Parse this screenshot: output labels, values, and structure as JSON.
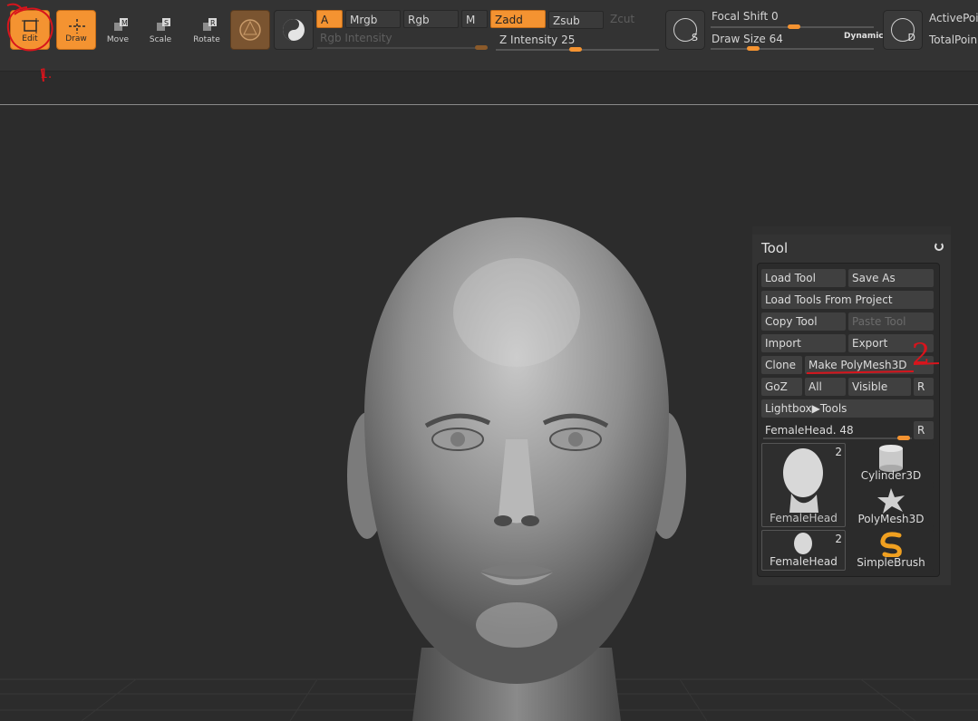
{
  "shelf": {
    "edit_label": "Edit",
    "draw_label": "Draw",
    "move_label": "Move",
    "scale_label": "Scale",
    "rotate_label": "Rotate",
    "modes": {
      "a": "A",
      "mrgb": "Mrgb",
      "rgb": "Rgb",
      "m": "M",
      "zadd": "Zadd",
      "zsub": "Zsub",
      "zcut": "Zcut"
    },
    "rgb_intensity_label": "Rgb Intensity",
    "z_intensity_label": "Z Intensity",
    "z_intensity_value": "25",
    "stroke_letter": "S",
    "focal_shift_label": "Focal Shift",
    "focal_shift_value": "0",
    "draw_size_label": "Draw Size",
    "draw_size_value": "64",
    "dynamic_label": "Dynamic",
    "d_letter": "D",
    "active_points_label": "ActivePoin",
    "total_points_label": "TotalPoin"
  },
  "tool_palette": {
    "title": "Tool",
    "load_tool": "Load Tool",
    "save_as": "Save As",
    "load_from_project": "Load Tools From Project",
    "copy_tool": "Copy Tool",
    "paste_tool": "Paste Tool",
    "import": "Import",
    "export": "Export",
    "clone": "Clone",
    "make_polymesh": "Make PolyMesh3D",
    "goz": "GoZ",
    "all": "All",
    "visible": "Visible",
    "r": "R",
    "lightbox_tools": "Lightbox▶Tools",
    "current_tool_label": "FemaleHead.",
    "current_tool_value": "48",
    "thumbs": [
      {
        "name": "FemaleHead",
        "count": "2"
      },
      {
        "name": "Cylinder3D",
        "count": ""
      },
      {
        "name": "PolyMesh3D",
        "count": ""
      },
      {
        "name": "FemaleHead",
        "count": "2"
      },
      {
        "name": "SimpleBrush",
        "count": ""
      }
    ]
  },
  "annotations": {
    "step1": "1.",
    "step2": "2"
  },
  "colors": {
    "accent": "#f49331",
    "annotation": "#d8141c",
    "background": "#2c2c2c"
  }
}
